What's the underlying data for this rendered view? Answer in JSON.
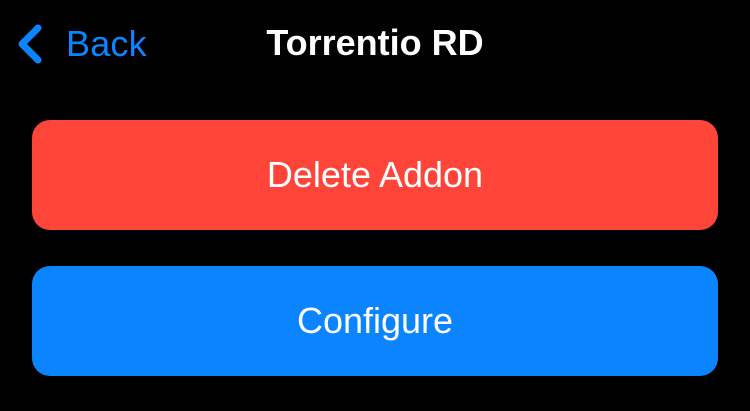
{
  "nav": {
    "back_label": "Back",
    "back_icon": "chevron-left-icon",
    "title": "Torrentio RD"
  },
  "actions": {
    "delete_label": "Delete Addon",
    "configure_label": "Configure"
  },
  "colors": {
    "background": "#000000",
    "accent": "#0A84FF",
    "destructive": "#FF453A",
    "text": "#FFFFFF"
  }
}
